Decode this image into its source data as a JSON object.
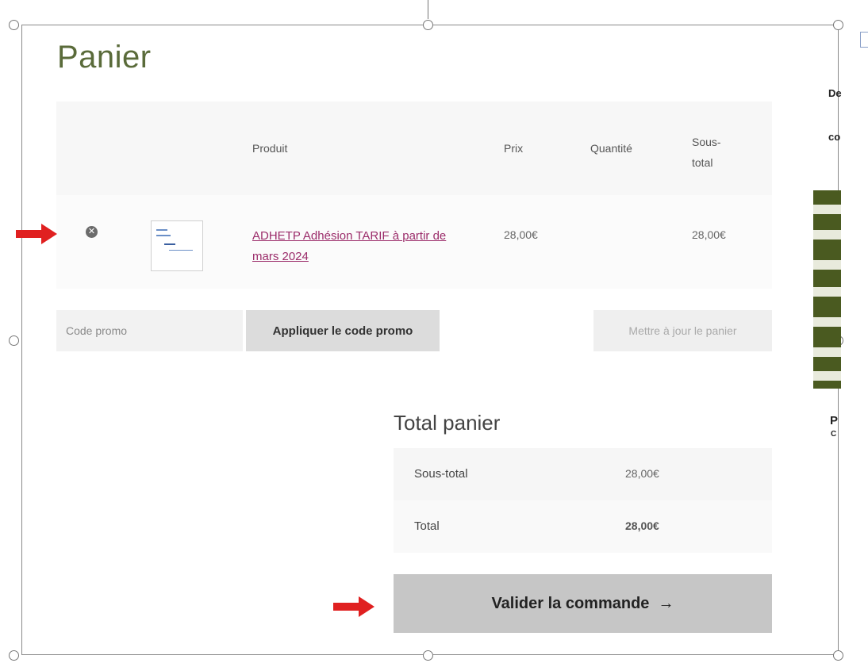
{
  "page": {
    "title": "Panier"
  },
  "cart": {
    "headers": {
      "product": "Produit",
      "price": "Prix",
      "quantity": "Quantité",
      "subtotal": "Sous-total"
    },
    "rows": [
      {
        "product": "ADHETP Adhésion TARIF à partir de mars 2024",
        "price": "28,00€",
        "subtotal": "28,00€"
      }
    ]
  },
  "coupon": {
    "placeholder": "Code promo",
    "apply_label": "Appliquer le code promo",
    "update_label": "Mettre à jour le panier"
  },
  "totals": {
    "title": "Total panier",
    "subtotal_label": "Sous-total",
    "subtotal_value": "28,00€",
    "total_label": "Total",
    "total_value": "28,00€"
  },
  "checkout": {
    "label": "Valider la commande",
    "arrow": "→"
  },
  "side_fragment": {
    "line1": "De",
    "line2": "co",
    "banner_text": "P",
    "banner_text2": "C"
  },
  "colors": {
    "accent_link": "#9b2c6a",
    "title_green": "#5a6b3a",
    "annotation_arrow": "#e02020",
    "side_banner": "#4a5a20"
  },
  "icons": {
    "remove": "circle-x-icon",
    "annotation": "red-arrow-icon"
  }
}
